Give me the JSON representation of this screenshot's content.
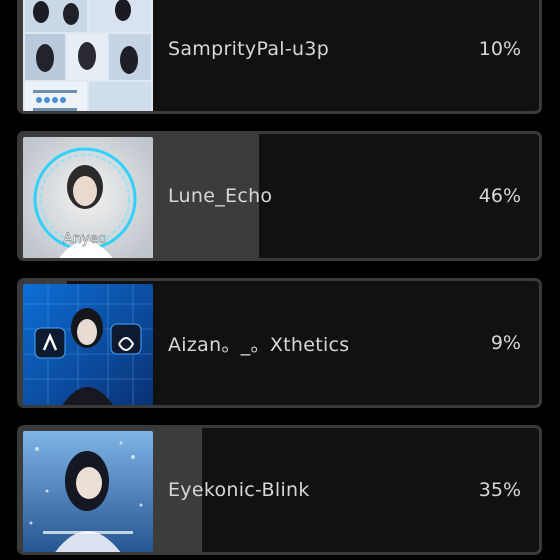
{
  "poll": {
    "options": [
      {
        "name": "SamprityPal-u3p",
        "percent_label": "10%",
        "fraction": 0.1,
        "thumb_text": "",
        "thumb": "image-collage"
      },
      {
        "name": "Lune_Echo",
        "percent_label": "46%",
        "fraction": 0.46,
        "thumb_text": "Anyeo",
        "thumb": "image-portrait-ring"
      },
      {
        "name": "Aizan。_。Xthetics",
        "percent_label": "9%",
        "fraction": 0.09,
        "thumb_text": "",
        "thumb": "image-portrait-app-icons"
      },
      {
        "name": "Eyekonic-Blink",
        "percent_label": "35%",
        "fraction": 0.35,
        "thumb_text": "",
        "thumb": "image-portrait-blue"
      }
    ]
  },
  "colors": {
    "background": "#000000",
    "card": "#111111",
    "card_border": "#3a3a3a",
    "fill": "#3c3c3c",
    "text": "#d7d7d7"
  }
}
